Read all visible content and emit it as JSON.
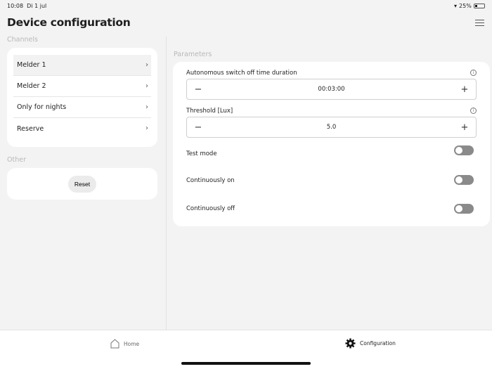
{
  "status_bar": {
    "time": "10:08",
    "date": "Di 1 jul",
    "battery": "25%"
  },
  "header": {
    "title": "Device configuration"
  },
  "channels": {
    "label": "Channels",
    "items": [
      {
        "label": "Melder 1"
      },
      {
        "label": "Melder 2"
      },
      {
        "label": "Only for nights"
      },
      {
        "label": "Reserve"
      }
    ]
  },
  "other": {
    "label": "Other",
    "reset_label": "Reset"
  },
  "parameters": {
    "label": "Parameters",
    "autonomous": {
      "label": "Autonomous switch off time duration",
      "value": "00:03:00"
    },
    "threshold": {
      "label": "Threshold [Lux]",
      "value": "5.0"
    },
    "toggles": [
      {
        "label": "Test mode",
        "on": false
      },
      {
        "label": "Continuously on",
        "on": false
      },
      {
        "label": "Continuously off",
        "on": false
      }
    ]
  },
  "bottom_nav": {
    "home": "Home",
    "configuration": "Configuration"
  }
}
